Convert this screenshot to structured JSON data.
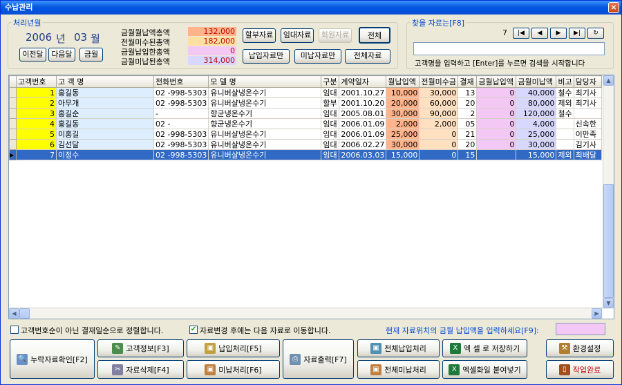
{
  "window": {
    "title": "수납관리",
    "close": "×"
  },
  "period": {
    "label": "처리년월",
    "year": "2006",
    "year_unit": "년",
    "month": "03",
    "month_unit": "월",
    "prev": "이전달",
    "next": "다음달",
    "current": "금월"
  },
  "summary": [
    {
      "label": "금월월납액총액",
      "value": "132,000",
      "color": "#FFB48C",
      "text": "#C00000"
    },
    {
      "label": "전월미수된총액",
      "value": "182,000",
      "color": "#FFE0A0",
      "text": "#C00000"
    },
    {
      "label": "금월납입한총액",
      "value": "0",
      "color": "#F4C8F4",
      "text": "#C00000"
    },
    {
      "label": "금월미납된총액",
      "value": "314,000",
      "color": "#D8D8FF",
      "text": "#C00000"
    }
  ],
  "filters": {
    "installment": "할부자료",
    "lease": "임대자료",
    "member": "회원자료",
    "all": "전체",
    "paid_only": "납입자료만",
    "unpaid_only": "미납자료만",
    "all_data": "전체자료"
  },
  "search": {
    "label": "찾을 자료는[F8]",
    "page": "7",
    "placeholder": "",
    "hint": "고객명을 입력하고 [Enter]를 누르면 검색을 시작합니다"
  },
  "grid": {
    "columns": [
      "고객번호",
      "고 객 명",
      "전화번호",
      "모  델  명",
      "구분",
      "계약일자",
      "월납입액",
      "전월미수금",
      "결재",
      "금월납입액",
      "금월미납액",
      "비고",
      "담당자"
    ],
    "rows": [
      {
        "id": "1",
        "name": "홍길동",
        "phone": "02   -998-5303",
        "model": "유니버샬냉온수기",
        "type": "임대",
        "date": "2001.10.27",
        "monthly": "10,000",
        "unpaid_prev": "30,000",
        "pay": "13",
        "paid": "0",
        "unpaid": "40,000",
        "note": "철수",
        "staff": "최기사"
      },
      {
        "id": "2",
        "name": "아무개",
        "phone": "02   -998-5303",
        "model": "유니버샬냉온수기",
        "type": "할부",
        "date": "2001.10.20",
        "monthly": "20,000",
        "unpaid_prev": "60,000",
        "pay": "20",
        "paid": "0",
        "unpaid": "80,000",
        "note": "제외",
        "staff": "최기사"
      },
      {
        "id": "3",
        "name": "홍길순",
        "phone": "     -",
        "model": "향균냉온수기",
        "type": "임대",
        "date": "2005.08.01",
        "monthly": "30,000",
        "unpaid_prev": "90,000",
        "pay": "2",
        "paid": "0",
        "unpaid": "120,000",
        "note": "철수",
        "staff": ""
      },
      {
        "id": "4",
        "name": "홍길동",
        "phone": "02   -",
        "model": "향균냉온수기",
        "type": "임대",
        "date": "2006.01.09",
        "monthly": "2,000",
        "unpaid_prev": "2,000",
        "pay": "05",
        "paid": "0",
        "unpaid": "4,000",
        "note": "",
        "staff": "신속한"
      },
      {
        "id": "5",
        "name": "이홍길",
        "phone": "02   -998-5303",
        "model": "유니버샬냉온수기",
        "type": "임대",
        "date": "2006.01.09",
        "monthly": "25,000",
        "unpaid_prev": "0",
        "pay": "21",
        "paid": "0",
        "unpaid": "25,000",
        "note": "",
        "staff": "이만족"
      },
      {
        "id": "6",
        "name": "김선달",
        "phone": "02   -998-5303",
        "model": "유니버샬냉온수기",
        "type": "임대",
        "date": "2006.02.27",
        "monthly": "30,000",
        "unpaid_prev": "0",
        "pay": "20",
        "paid": "0",
        "unpaid": "30,000",
        "note": "",
        "staff": "김기사"
      },
      {
        "id": "7",
        "name": "이정수",
        "phone": "02   -998-5303",
        "model": "유니버샬냉온수기",
        "type": "임대",
        "date": "2006.03.03",
        "monthly": "15,000",
        "unpaid_prev": "0",
        "pay": "15",
        "paid": "",
        "unpaid": "15,000",
        "note": "제외",
        "staff": "최배달"
      }
    ],
    "selected_row": 6
  },
  "options": {
    "sort_label": "고객번호순이 아닌 결재일순으로 정렬합니다.",
    "sort_checked": false,
    "next_label": "자료변경 후에는 다음 자료로 이동합니다.",
    "next_checked": true,
    "prompt": "현재 자료위치의 금월 납입액을 입력하세요[F9]:"
  },
  "actions": {
    "missing": "누락자료확인[F2]",
    "customer_info": "고객정보[F3]",
    "delete": "자료삭제[F4]",
    "pay": "납입처리[F5]",
    "unpay": "미납처리[F6]",
    "print": "자료출력[F7]",
    "pay_all": "전체납입처리",
    "unpay_all": "전체미납처리",
    "excel_save": "엑 셀 로 저장하기",
    "excel_paste": "엑셀화일 붙여넣기",
    "settings": "환경설정",
    "done": "작업완료"
  }
}
